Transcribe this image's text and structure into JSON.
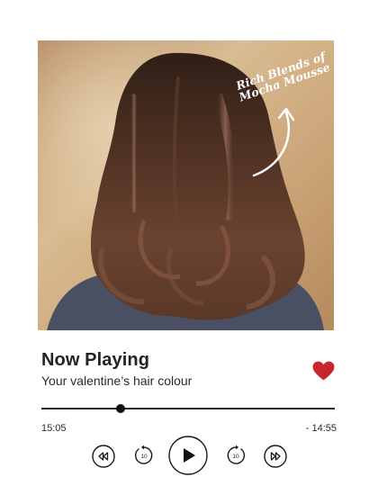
{
  "artwork": {
    "caption_line1": "Rich Blends of",
    "caption_line2": "Mocha Mousse",
    "hair_color": "#5a3a28",
    "background_color": "#c9a47a"
  },
  "player": {
    "title": "Now Playing",
    "subtitle": "Your valentine’s hair colour",
    "elapsed": "15:05",
    "remaining": "- 14:55",
    "progress_fraction": 0.27,
    "liked": true,
    "heart_color": "#c8262b"
  },
  "controls": {
    "rewind_icon": "rewind-icon",
    "skip_back_icon": "replay-10-icon",
    "skip_back_seconds": "10",
    "play_icon": "play-icon",
    "skip_forward_icon": "forward-10-icon",
    "skip_forward_seconds": "10",
    "fast_forward_icon": "fast-forward-icon"
  }
}
